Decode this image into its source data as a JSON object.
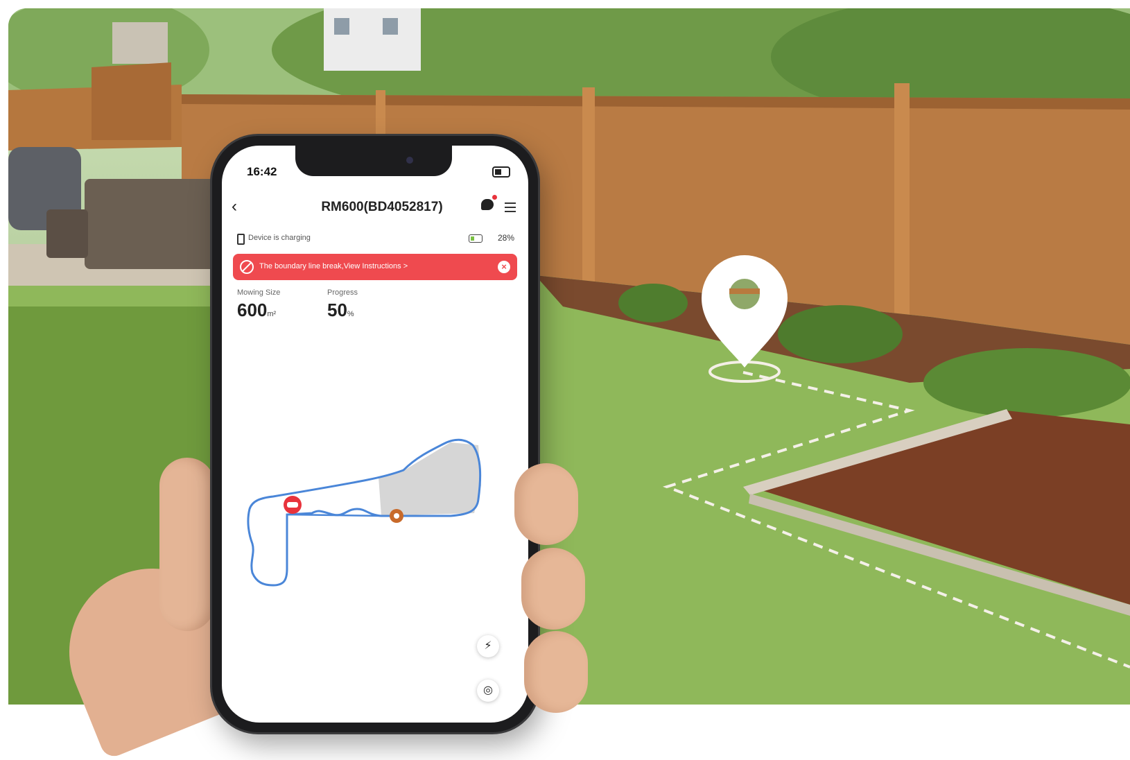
{
  "phone": {
    "status_time": "16:42",
    "title": "RM600(BD4052817)",
    "charging_status": "Device is charging",
    "battery_percent": "28%",
    "alert_message": "The boundary line break,View Instructions >",
    "stats": [
      {
        "label": "Mowing Size",
        "value": "600",
        "unit": "m²"
      },
      {
        "label": "Progress",
        "value": "50",
        "unit": "%"
      }
    ],
    "progress_fraction": 0.5
  },
  "icons": [
    "back-icon",
    "chat-icon",
    "notification-dot",
    "menu-icon",
    "plug-icon",
    "battery-icon",
    "boundary-alert-icon",
    "close-icon",
    "robot-marker-icon",
    "base-station-icon",
    "lightning-icon",
    "locate-icon",
    "location-pin-icon"
  ],
  "colors": {
    "alert": "#ef4a4f",
    "boundary": "#4a86d8",
    "mowed_area": "#d6d6d6",
    "dashed_boundary": "#f4f0e8"
  }
}
